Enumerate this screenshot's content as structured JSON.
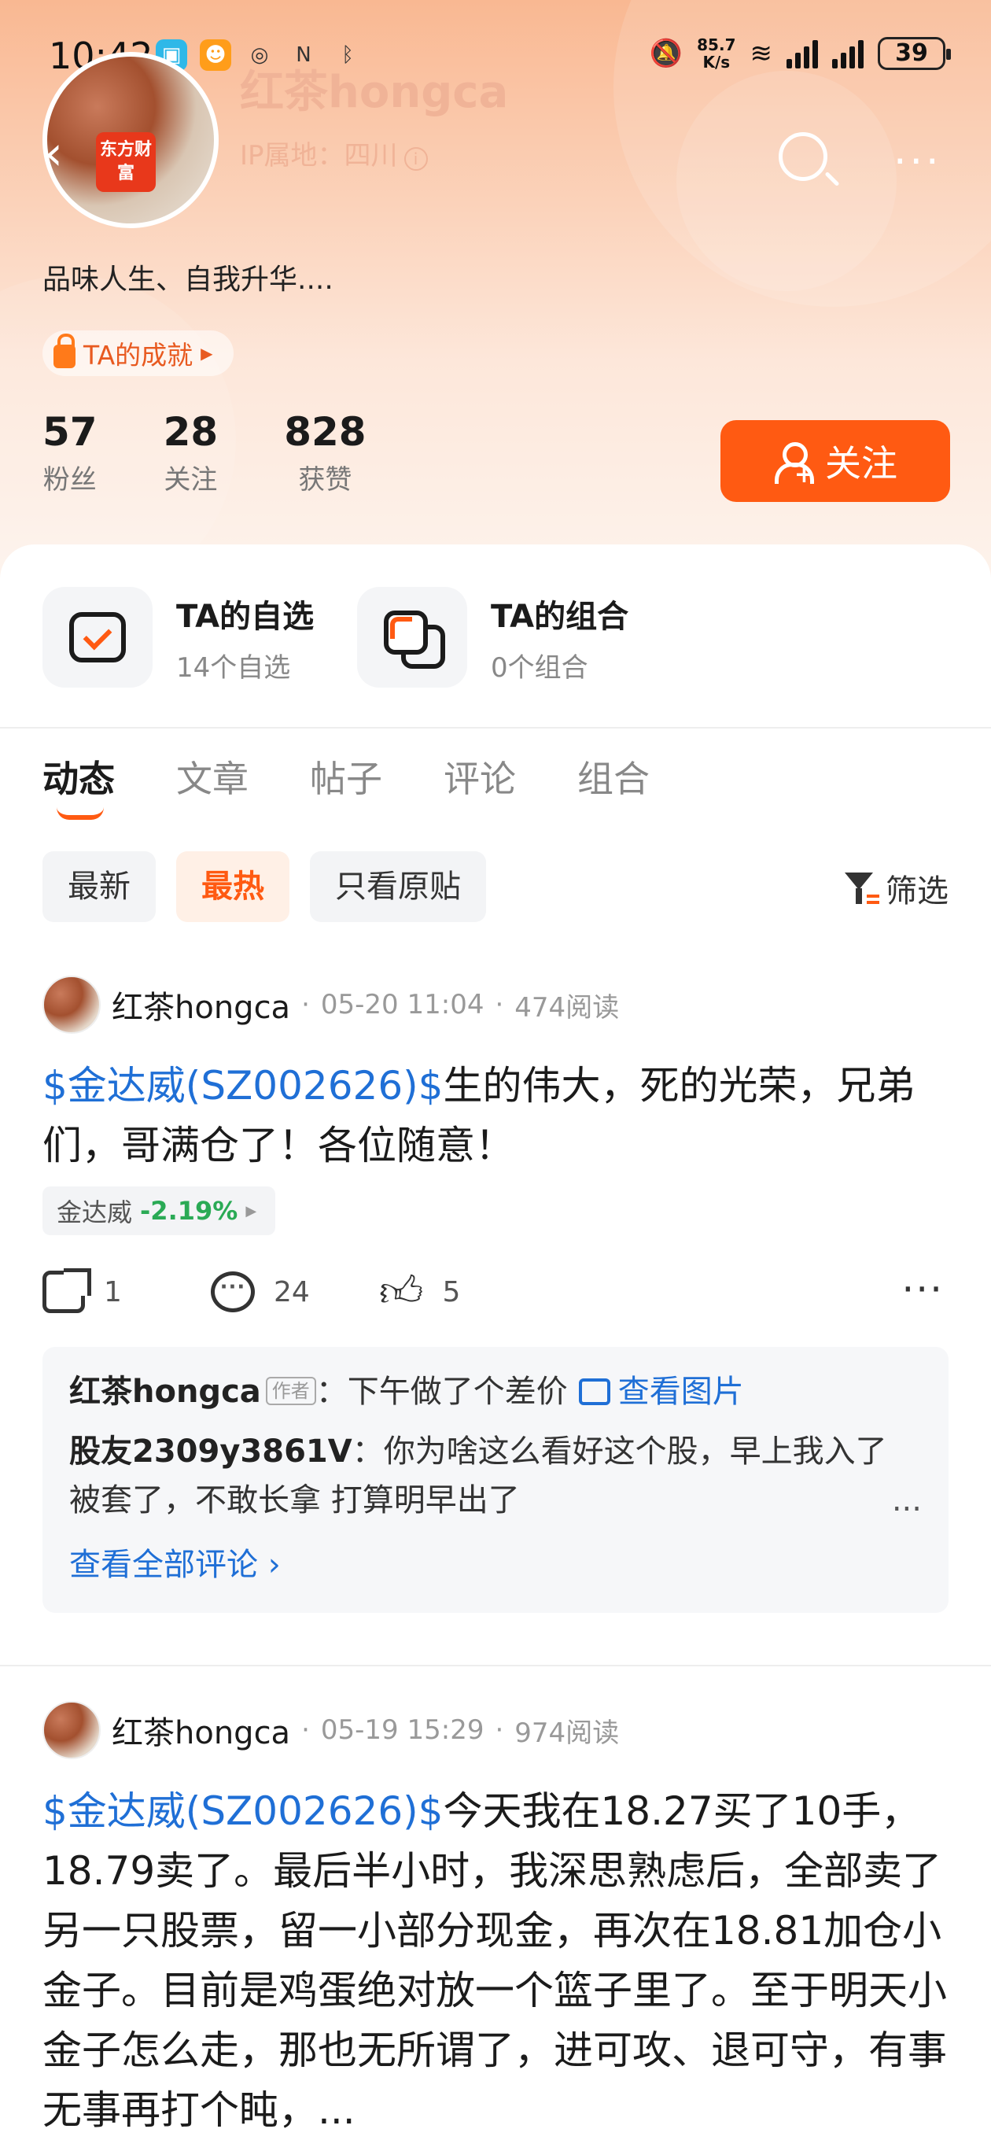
{
  "statusbar": {
    "time": "10:42",
    "speed_top": "85.7",
    "speed_bottom": "K/s",
    "battery": "39"
  },
  "profile": {
    "name": "红茶hongca",
    "ip_location": "IP属地：四川",
    "avatar_logo": "东方财富",
    "bio": "品味人生、自我升华....",
    "achievement_label": "TA的成就",
    "stats": [
      {
        "value": "57",
        "label": "粉丝"
      },
      {
        "value": "28",
        "label": "关注"
      },
      {
        "value": "828",
        "label": "获赞"
      }
    ],
    "follow_label": "关注"
  },
  "quick_links": [
    {
      "title": "TA的自选",
      "subtitle": "14个自选"
    },
    {
      "title": "TA的组合",
      "subtitle": "0个组合"
    }
  ],
  "tabs": [
    "动态",
    "文章",
    "帖子",
    "评论",
    "组合"
  ],
  "filters": {
    "chips": [
      "最新",
      "最热",
      "只看原贴"
    ],
    "filter_label": "筛选"
  },
  "posts": [
    {
      "author": "红茶hongca",
      "date": "05-20 11:04",
      "reads": "474阅读",
      "stock_link": "$金达威(SZ002626)$",
      "text": "生的伟大，死的光荣，兄弟们，哥满仓了！各位随意！",
      "stock_chip": {
        "name": "金达威",
        "change": "-2.19%"
      },
      "actions": {
        "shares": "1",
        "comments": "24",
        "likes": "5"
      },
      "comment_list": [
        {
          "author": "红茶hongca",
          "tag": "作者",
          "text": "下午做了个差价",
          "link": "查看图片"
        },
        {
          "author": "股友2309y3861V",
          "text": "你为啥这么看好这个股，早上我入了 被套了，不敢长拿 打算明早出了",
          "more": "..."
        }
      ],
      "view_all": "查看全部评论"
    },
    {
      "author": "红茶hongca",
      "date": "05-19 15:29",
      "reads": "974阅读",
      "stock_link": "$金达威(SZ002626)$",
      "text": "今天我在18.27买了10手，18.79卖了。最后半小时，我深思熟虑后，全部卖了另一只股票，留一小部分现金，再次在18.81加仓小金子。目前是鸡蛋绝对放一个篮子里了。至于明天小金子怎么走，那也无所谓了，进可攻、退可守，有事无事再打个盹，..."
    }
  ]
}
